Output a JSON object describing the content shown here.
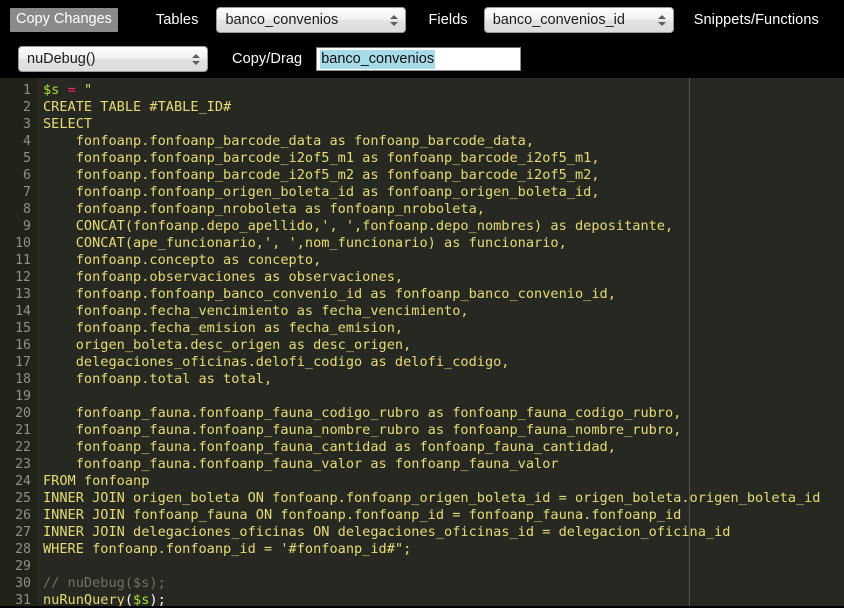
{
  "toolbar": {
    "copy_changes_label": "Copy Changes",
    "tables_label": "Tables",
    "tables_value": "banco_convenios",
    "fields_label": "Fields",
    "fields_value": "banco_convenios_id",
    "snippets_label": "Snippets/Functions"
  },
  "toolbar2": {
    "function_value": "nuDebug()",
    "copydrag_label": "Copy/Drag",
    "copydrag_value": "banco_convenios"
  },
  "colors": {
    "toolbar_bg": "#000000",
    "editor_bg": "#272822",
    "gutter_bg": "#222318",
    "string": "#e6db74",
    "variable": "#a6e22e",
    "operator": "#f92672",
    "comment": "#75715e",
    "line_number": "#8f908a",
    "selection_highlight": "#a8dbe8",
    "button_bg": "#8a8a8a",
    "guide_line": "#51544a"
  },
  "editor": {
    "total_lines": 31,
    "lines": [
      {
        "n": 1,
        "text": "$s = \""
      },
      {
        "n": 2,
        "text": "CREATE TABLE #TABLE_ID#"
      },
      {
        "n": 3,
        "text": "SELECT"
      },
      {
        "n": 4,
        "text": "    fonfoanp.fonfoanp_barcode_data as fonfoanp_barcode_data,"
      },
      {
        "n": 5,
        "text": "    fonfoanp.fonfoanp_barcode_i2of5_m1 as fonfoanp_barcode_i2of5_m1,"
      },
      {
        "n": 6,
        "text": "    fonfoanp.fonfoanp_barcode_i2of5_m2 as fonfoanp_barcode_i2of5_m2,"
      },
      {
        "n": 7,
        "text": "    fonfoanp.fonfoanp_origen_boleta_id as fonfoanp_origen_boleta_id,"
      },
      {
        "n": 8,
        "text": "    fonfoanp.fonfoanp_nroboleta as fonfoanp_nroboleta,"
      },
      {
        "n": 9,
        "text": "    CONCAT(fonfoanp.depo_apellido,', ',fonfoanp.depo_nombres) as depositante,"
      },
      {
        "n": 10,
        "text": "    CONCAT(ape_funcionario,', ',nom_funcionario) as funcionario,"
      },
      {
        "n": 11,
        "text": "    fonfoanp.concepto as concepto,"
      },
      {
        "n": 12,
        "text": "    fonfoanp.observaciones as observaciones,"
      },
      {
        "n": 13,
        "text": "    fonfoanp.fonfoanp_banco_convenio_id as fonfoanp_banco_convenio_id,"
      },
      {
        "n": 14,
        "text": "    fonfoanp.fecha_vencimiento as fecha_vencimiento,"
      },
      {
        "n": 15,
        "text": "    fonfoanp.fecha_emision as fecha_emision,"
      },
      {
        "n": 16,
        "text": "    origen_boleta.desc_origen as desc_origen,"
      },
      {
        "n": 17,
        "text": "    delegaciones_oficinas.delofi_codigo as delofi_codigo,"
      },
      {
        "n": 18,
        "text": "    fonfoanp.total as total,"
      },
      {
        "n": 19,
        "text": ""
      },
      {
        "n": 20,
        "text": "    fonfoanp_fauna.fonfoanp_fauna_codigo_rubro as fonfoanp_fauna_codigo_rubro,"
      },
      {
        "n": 21,
        "text": "    fonfoanp_fauna.fonfoanp_fauna_nombre_rubro as fonfoanp_fauna_nombre_rubro,"
      },
      {
        "n": 22,
        "text": "    fonfoanp_fauna.fonfoanp_fauna_cantidad as fonfoanp_fauna_cantidad,"
      },
      {
        "n": 23,
        "text": "    fonfoanp_fauna.fonfoanp_fauna_valor as fonfoanp_fauna_valor"
      },
      {
        "n": 24,
        "text": "FROM fonfoanp"
      },
      {
        "n": 25,
        "text": "INNER JOIN origen_boleta ON fonfoanp.fonfoanp_origen_boleta_id = origen_boleta.origen_boleta_id"
      },
      {
        "n": 26,
        "text": "INNER JOIN fonfoanp_fauna ON fonfoanp.fonfoanp_id = fonfoanp_fauna.fonfoanp_id"
      },
      {
        "n": 27,
        "text": "INNER JOIN delegaciones_oficinas ON delegaciones_oficinas_id = delegacion_oficina_id"
      },
      {
        "n": 28,
        "text": "WHERE fonfoanp.fonfoanp_id = '#fonfoanp_id#\";"
      },
      {
        "n": 29,
        "text": ""
      },
      {
        "n": 30,
        "text": "// nuDebug($s);"
      },
      {
        "n": 31,
        "text": "nuRunQuery($s);"
      }
    ]
  }
}
